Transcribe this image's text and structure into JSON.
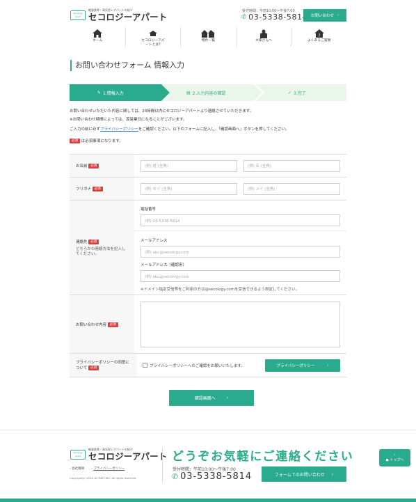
{
  "header": {
    "logo_mark": "Secology Apart",
    "logo_tagline": "軽量鉄骨・高気密レアパートの紹介",
    "logo_name": "セコロジーアパート",
    "hours": "受付時間：午前10:00〜午後7:00",
    "phone": "03-5338-5814",
    "contact_button": "お問い合わせ",
    "colors": {
      "accent": "#2bab8e",
      "required": "#d94040",
      "link": "#2a74b7"
    }
  },
  "nav": [
    {
      "label": "ホーム",
      "icon": "home-icon"
    },
    {
      "label": "セコロジーアパートとは?",
      "icon": "building-icon"
    },
    {
      "label": "物件一覧",
      "icon": "houses-icon"
    },
    {
      "label": "大家さんへ",
      "icon": "owner-icon"
    },
    {
      "label": "よくあるご質問",
      "icon": "faq-house-icon"
    }
  ],
  "page_title": "お問い合わせフォーム 情報入力",
  "steps": [
    {
      "label": "1.情報入力",
      "icon": "pencil-icon",
      "state": "active"
    },
    {
      "label": "2.入力内容の確認",
      "icon": "clipboard-icon",
      "state": "pending"
    },
    {
      "label": "3.完了",
      "icon": "check-circle-icon",
      "state": "pending"
    }
  ],
  "intro": {
    "line1": "お問い合わせいただいた内容に関しては、24時間以内にセコロジーアパートより連絡させていただきます。",
    "line2": "※お問い合わせ時間によっては、翌営業日になることがございます。",
    "line3_pre": "ご入力の前に必ず",
    "line3_link": "プライバシーポリシー",
    "line3_post": "をご確認ください。以下のフォームに記入し、「確認画面へ」ボタンを押してください。",
    "required_note": "は必須事項になります。"
  },
  "required_badge": "必須",
  "form": {
    "name": {
      "label": "お名前",
      "last_placeholder": "(例) 姓 (全角)",
      "first_placeholder": "(例) 名 (全角)"
    },
    "furigana": {
      "label": "フリガナ",
      "last_placeholder": "(例) セイ (全角)",
      "first_placeholder": "(例) メイ (全角)"
    },
    "contact": {
      "label": "連絡先",
      "sub": "どちらかの連絡方法を記入してください。",
      "phone_label": "電話番号",
      "phone_placeholder": "(例) 03-5338-5814",
      "email_label": "メールアドレス",
      "email_placeholder": "(例) abc@secology.com",
      "email_confirm_label": "メールアドレス（確認用）",
      "email_confirm_placeholder": "(例) abc@secology.com",
      "domain_note": "※ドメイン指定受信等をご利用の方は@secology.comを受信できるよう設定してください。"
    },
    "inquiry": {
      "label": "お問い合わせ内容"
    },
    "privacy": {
      "label": "プライバシーポリシーの同意について",
      "checkbox_text": "プライバシーポリシーへのご確認をお願いいたします。",
      "button": "プライバシーポリシー"
    }
  },
  "confirm_button": "確認画面へ",
  "footer": {
    "links": [
      "会社概要",
      "プライバシーポリシー"
    ],
    "copyright": "Copyright(c) 2014 ACTNET.INC. All rights reserved.",
    "slogan": "どうぞお気軽にご連絡ください",
    "hours": "受付時間：午前10:00〜午後7:00",
    "phone": "03-5338-5814",
    "form_button": "フォームでのお問い合わせ",
    "to_top": "トップへ"
  }
}
